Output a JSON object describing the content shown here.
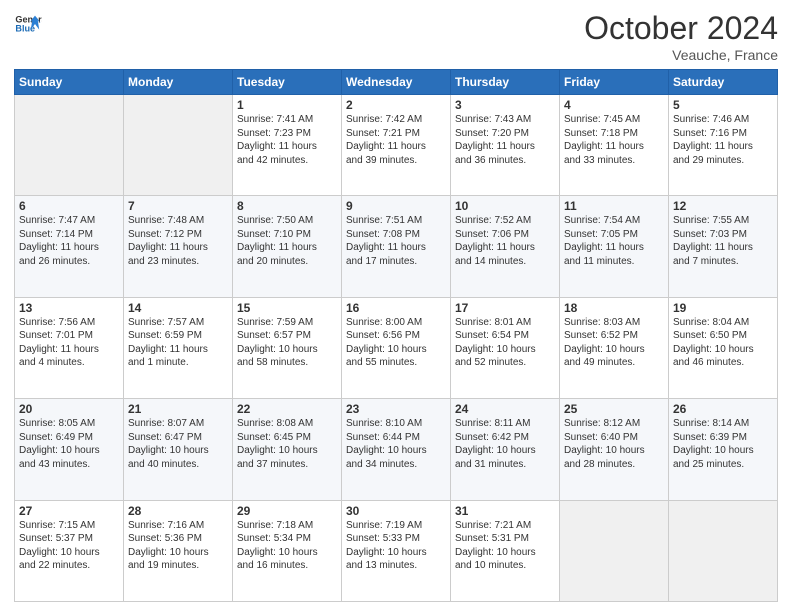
{
  "header": {
    "logo_line1": "General",
    "logo_line2": "Blue",
    "month": "October 2024",
    "location": "Veauche, France"
  },
  "weekdays": [
    "Sunday",
    "Monday",
    "Tuesday",
    "Wednesday",
    "Thursday",
    "Friday",
    "Saturday"
  ],
  "weeks": [
    [
      {
        "day": "",
        "info": ""
      },
      {
        "day": "",
        "info": ""
      },
      {
        "day": "1",
        "info": "Sunrise: 7:41 AM\nSunset: 7:23 PM\nDaylight: 11 hours\nand 42 minutes."
      },
      {
        "day": "2",
        "info": "Sunrise: 7:42 AM\nSunset: 7:21 PM\nDaylight: 11 hours\nand 39 minutes."
      },
      {
        "day": "3",
        "info": "Sunrise: 7:43 AM\nSunset: 7:20 PM\nDaylight: 11 hours\nand 36 minutes."
      },
      {
        "day": "4",
        "info": "Sunrise: 7:45 AM\nSunset: 7:18 PM\nDaylight: 11 hours\nand 33 minutes."
      },
      {
        "day": "5",
        "info": "Sunrise: 7:46 AM\nSunset: 7:16 PM\nDaylight: 11 hours\nand 29 minutes."
      }
    ],
    [
      {
        "day": "6",
        "info": "Sunrise: 7:47 AM\nSunset: 7:14 PM\nDaylight: 11 hours\nand 26 minutes."
      },
      {
        "day": "7",
        "info": "Sunrise: 7:48 AM\nSunset: 7:12 PM\nDaylight: 11 hours\nand 23 minutes."
      },
      {
        "day": "8",
        "info": "Sunrise: 7:50 AM\nSunset: 7:10 PM\nDaylight: 11 hours\nand 20 minutes."
      },
      {
        "day": "9",
        "info": "Sunrise: 7:51 AM\nSunset: 7:08 PM\nDaylight: 11 hours\nand 17 minutes."
      },
      {
        "day": "10",
        "info": "Sunrise: 7:52 AM\nSunset: 7:06 PM\nDaylight: 11 hours\nand 14 minutes."
      },
      {
        "day": "11",
        "info": "Sunrise: 7:54 AM\nSunset: 7:05 PM\nDaylight: 11 hours\nand 11 minutes."
      },
      {
        "day": "12",
        "info": "Sunrise: 7:55 AM\nSunset: 7:03 PM\nDaylight: 11 hours\nand 7 minutes."
      }
    ],
    [
      {
        "day": "13",
        "info": "Sunrise: 7:56 AM\nSunset: 7:01 PM\nDaylight: 11 hours\nand 4 minutes."
      },
      {
        "day": "14",
        "info": "Sunrise: 7:57 AM\nSunset: 6:59 PM\nDaylight: 11 hours\nand 1 minute."
      },
      {
        "day": "15",
        "info": "Sunrise: 7:59 AM\nSunset: 6:57 PM\nDaylight: 10 hours\nand 58 minutes."
      },
      {
        "day": "16",
        "info": "Sunrise: 8:00 AM\nSunset: 6:56 PM\nDaylight: 10 hours\nand 55 minutes."
      },
      {
        "day": "17",
        "info": "Sunrise: 8:01 AM\nSunset: 6:54 PM\nDaylight: 10 hours\nand 52 minutes."
      },
      {
        "day": "18",
        "info": "Sunrise: 8:03 AM\nSunset: 6:52 PM\nDaylight: 10 hours\nand 49 minutes."
      },
      {
        "day": "19",
        "info": "Sunrise: 8:04 AM\nSunset: 6:50 PM\nDaylight: 10 hours\nand 46 minutes."
      }
    ],
    [
      {
        "day": "20",
        "info": "Sunrise: 8:05 AM\nSunset: 6:49 PM\nDaylight: 10 hours\nand 43 minutes."
      },
      {
        "day": "21",
        "info": "Sunrise: 8:07 AM\nSunset: 6:47 PM\nDaylight: 10 hours\nand 40 minutes."
      },
      {
        "day": "22",
        "info": "Sunrise: 8:08 AM\nSunset: 6:45 PM\nDaylight: 10 hours\nand 37 minutes."
      },
      {
        "day": "23",
        "info": "Sunrise: 8:10 AM\nSunset: 6:44 PM\nDaylight: 10 hours\nand 34 minutes."
      },
      {
        "day": "24",
        "info": "Sunrise: 8:11 AM\nSunset: 6:42 PM\nDaylight: 10 hours\nand 31 minutes."
      },
      {
        "day": "25",
        "info": "Sunrise: 8:12 AM\nSunset: 6:40 PM\nDaylight: 10 hours\nand 28 minutes."
      },
      {
        "day": "26",
        "info": "Sunrise: 8:14 AM\nSunset: 6:39 PM\nDaylight: 10 hours\nand 25 minutes."
      }
    ],
    [
      {
        "day": "27",
        "info": "Sunrise: 7:15 AM\nSunset: 5:37 PM\nDaylight: 10 hours\nand 22 minutes."
      },
      {
        "day": "28",
        "info": "Sunrise: 7:16 AM\nSunset: 5:36 PM\nDaylight: 10 hours\nand 19 minutes."
      },
      {
        "day": "29",
        "info": "Sunrise: 7:18 AM\nSunset: 5:34 PM\nDaylight: 10 hours\nand 16 minutes."
      },
      {
        "day": "30",
        "info": "Sunrise: 7:19 AM\nSunset: 5:33 PM\nDaylight: 10 hours\nand 13 minutes."
      },
      {
        "day": "31",
        "info": "Sunrise: 7:21 AM\nSunset: 5:31 PM\nDaylight: 10 hours\nand 10 minutes."
      },
      {
        "day": "",
        "info": ""
      },
      {
        "day": "",
        "info": ""
      }
    ]
  ]
}
